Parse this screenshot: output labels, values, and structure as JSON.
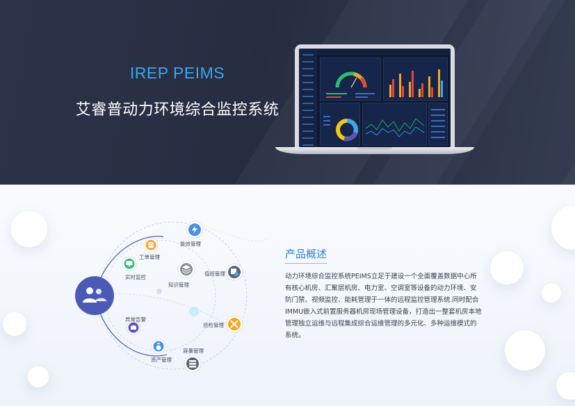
{
  "hero": {
    "title": "IREP PEIMS",
    "subtitle": "艾睿普动力环境综合监控系统"
  },
  "diagram": {
    "center_icon": "users-icon",
    "nodes": [
      {
        "key": "energy",
        "label": "能效管理",
        "icon": "lightning-icon",
        "color": "#4a90e2"
      },
      {
        "key": "workorder",
        "label": "工单管理",
        "icon": "document-icon",
        "color": "#f2a93b"
      },
      {
        "key": "realtime",
        "label": "实时监控",
        "icon": "monitor-icon",
        "color": "#3cb878"
      },
      {
        "key": "knowledge",
        "label": "知识管理",
        "icon": "layers-icon",
        "color": "#8a8f99"
      },
      {
        "key": "duty",
        "label": "值班管理",
        "icon": "calendar-clock-icon",
        "color": "#5b6475"
      },
      {
        "key": "alarm",
        "label": "异常告警",
        "icon": "alarm-icon",
        "color": "#5a55b8"
      },
      {
        "key": "inspection",
        "label": "巡检管理",
        "icon": "tools-icon",
        "color": "#f5a623"
      },
      {
        "key": "asset",
        "label": "资产管理",
        "icon": "money-bag-icon",
        "color": "#4a90e2"
      },
      {
        "key": "capacity",
        "label": "容量管理",
        "icon": "server-icon",
        "color": "#5b6475"
      }
    ]
  },
  "overview": {
    "title": "产品概述",
    "body": "动力环境综合监控系统PEIMS立足于建设一个全面覆盖数据中心所有核心机房、汇聚层机房、电力室、空调室等设备的动力环境、安防门禁、视频监控、能耗管理于一体的远程监控管理系统.同时配合IMMU嵌入式前置服务器机房现场管理设备，打造出一整套机房本地管理独立运维与远程集成综合运维管理的多元化、多种运维模式的系统。"
  },
  "colors": {
    "accent": "#3aa7ee",
    "overview_title": "#2d7fd6",
    "center": "#4b5bb5",
    "hero_bg": "#2a3045"
  }
}
